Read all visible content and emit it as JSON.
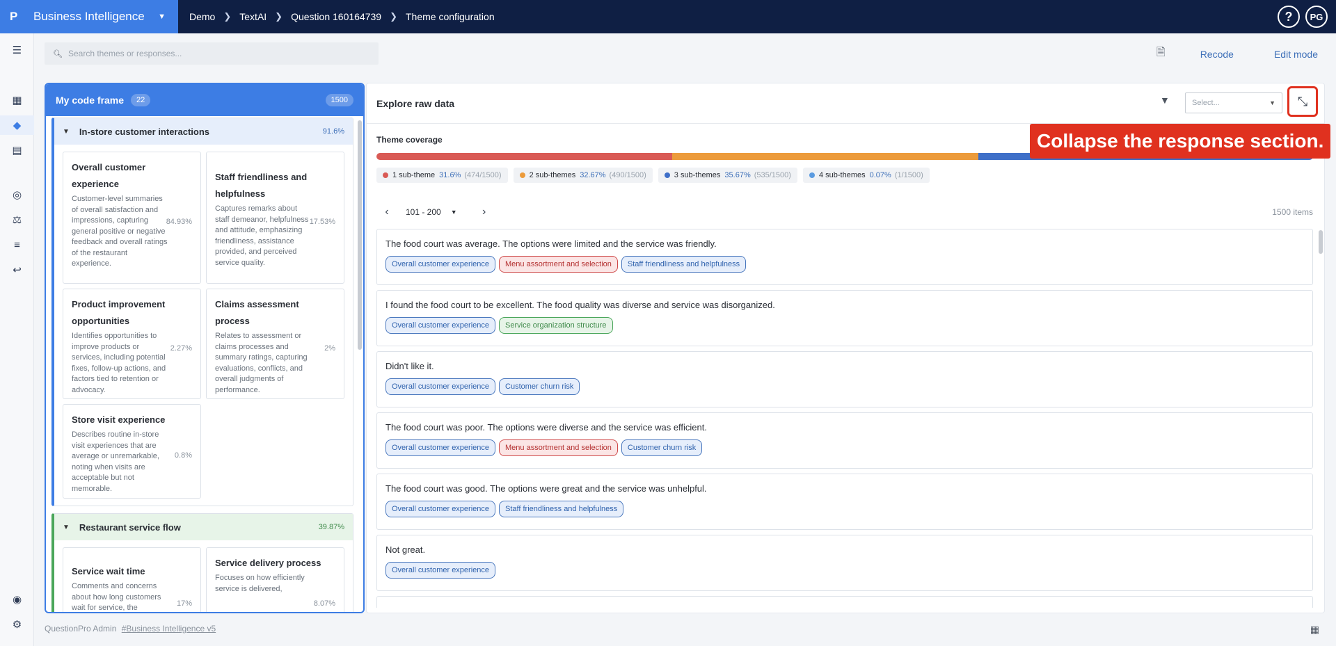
{
  "app": {
    "logo": "P",
    "name": "Business Intelligence"
  },
  "breadcrumb": [
    "Demo",
    "TextAI",
    "Question 160164739",
    "Theme configuration"
  ],
  "user": {
    "initials": "PG",
    "help": "?"
  },
  "search": {
    "placeholder": "Search themes or responses..."
  },
  "header_actions": {
    "recode": "Recode",
    "edit_mode": "Edit mode"
  },
  "code_frame": {
    "title": "My code frame",
    "count": "22",
    "total": "1500",
    "groups": [
      {
        "title": "In-store customer interactions",
        "pct": "91.6%",
        "cards": [
          {
            "title": "Overall customer experience",
            "desc": "Customer-level summaries of overall satisfaction and impressions, capturing general positive or negative feedback and overall ratings of the restaurant experience.",
            "pct": "84.93%"
          },
          {
            "title": "Staff friendliness and helpfulness",
            "desc": "Captures remarks about staff demeanor, helpfulness and attitude, emphasizing friendliness, assistance provided, and perceived service quality.",
            "pct": "17.53%"
          },
          {
            "title": "Product improvement opportunities",
            "desc": "Identifies opportunities to improve products or services, including potential fixes, follow-up actions, and factors tied to retention or advocacy.",
            "pct": "2.27%"
          },
          {
            "title": "Claims assessment process",
            "desc": "Relates to assessment or claims processes and summary ratings, capturing evaluations, conflicts, and overall judgments of performance.",
            "pct": "2%"
          },
          {
            "title": "Store visit experience",
            "desc": "Describes routine in-store visit experiences that are average or unremarkable, noting when visits are acceptable but not memorable.",
            "pct": "0.8%"
          }
        ]
      },
      {
        "title": "Restaurant service flow",
        "pct": "39.87%",
        "cards": [
          {
            "title": "Service wait time",
            "desc": "Comments and concerns about how long customers wait for service, the",
            "pct": "17%"
          },
          {
            "title": "Service delivery process",
            "desc": "Focuses on how efficiently service is delivered,",
            "pct": "8.07%"
          }
        ]
      }
    ]
  },
  "explore": {
    "title": "Explore raw data",
    "select_placeholder": "Select...",
    "coverage_label": "Theme coverage",
    "coverage": [
      {
        "label": "1 sub-theme",
        "pct": "31.6%",
        "count": "(474/1500)",
        "value": 31.6,
        "color": "#d95a55"
      },
      {
        "label": "2 sub-themes",
        "pct": "32.67%",
        "count": "(490/1500)",
        "value": 32.67,
        "color": "#ec9b3b"
      },
      {
        "label": "3 sub-themes",
        "pct": "35.67%",
        "count": "(535/1500)",
        "value": 35.67,
        "color": "#3e6fc8"
      },
      {
        "label": "4 sub-themes",
        "pct": "0.07%",
        "count": "(1/1500)",
        "value": 0.07,
        "color": "#5b9be0"
      }
    ],
    "pager": {
      "range": "101 - 200",
      "items": "1500 items"
    },
    "responses": [
      {
        "text": "The food court was average. The options were limited and the service was friendly.",
        "tags": [
          {
            "label": "Overall customer experience",
            "kind": "blue"
          },
          {
            "label": "Menu assortment and selection",
            "kind": "red"
          },
          {
            "label": "Staff friendliness and helpfulness",
            "kind": "blue"
          }
        ]
      },
      {
        "text": "I found the food court to be excellent. The food quality was diverse and service was disorganized.",
        "tags": [
          {
            "label": "Overall customer experience",
            "kind": "blue"
          },
          {
            "label": "Service organization structure",
            "kind": "green"
          }
        ]
      },
      {
        "text": "Didn't like it.",
        "tags": [
          {
            "label": "Overall customer experience",
            "kind": "blue"
          },
          {
            "label": "Customer churn risk",
            "kind": "blue"
          }
        ]
      },
      {
        "text": "The food court was poor. The options were diverse and the service was efficient.",
        "tags": [
          {
            "label": "Overall customer experience",
            "kind": "blue"
          },
          {
            "label": "Menu assortment and selection",
            "kind": "red"
          },
          {
            "label": "Customer churn risk",
            "kind": "blue"
          }
        ]
      },
      {
        "text": "The food court was good. The options were great and the service was unhelpful.",
        "tags": [
          {
            "label": "Overall customer experience",
            "kind": "blue"
          },
          {
            "label": "Staff friendliness and helpfulness",
            "kind": "blue"
          }
        ]
      },
      {
        "text": "Not great.",
        "tags": [
          {
            "label": "Overall customer experience",
            "kind": "blue"
          }
        ]
      }
    ]
  },
  "tooltip": {
    "text": "Collapse the response section."
  },
  "footer": {
    "prefix": "QuestionPro Admin",
    "link": "#Business Intelligence v5"
  },
  "icons": [
    "menu-icon",
    "dashboard-icon",
    "diamond-icon",
    "report-icon",
    "target-icon",
    "scale-icon",
    "list-icon",
    "reply-icon",
    "user-shield-icon",
    "gear-icon",
    "filter-icon",
    "collapse-icon",
    "pdf-icon",
    "chevron-left-icon",
    "chevron-right-icon",
    "chevron-down-icon",
    "search-icon",
    "calculator-icon"
  ]
}
